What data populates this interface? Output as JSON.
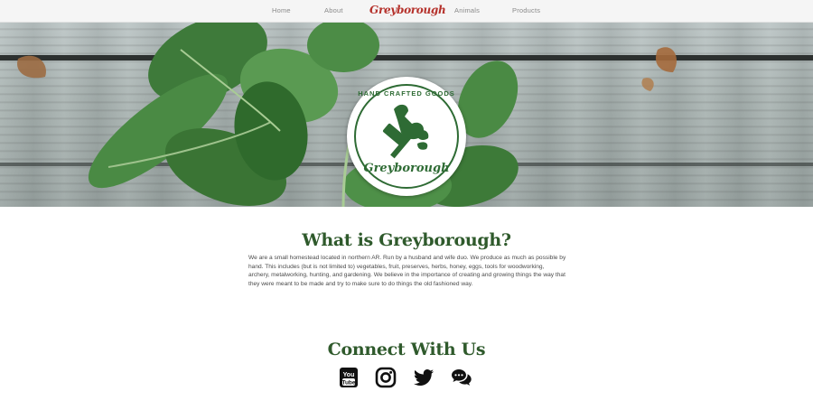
{
  "nav": {
    "items": [
      {
        "label": "Home"
      },
      {
        "label": "About"
      },
      {
        "label": "Animals"
      },
      {
        "label": "Products"
      }
    ],
    "brand": "Greyborough"
  },
  "hero": {
    "badge_top": "HAND CRAFTED GOODS",
    "badge_name": "Greyborough",
    "icon": "rooster-hammer-logo"
  },
  "about": {
    "title": "What is Greyborough?",
    "text": "We are a small homestead located in northern AR. Run by a husband and wife duo. We produce as much as possible by hand. This includes (but is not limited to) vegetables, fruit, preserves, herbs, honey, eggs, tools for woodworking, archery, metalworking, hunting, and gardening. We believe in the importance of creating and growing things the way that they were meant to be made and try to make sure to do things the old fashioned way."
  },
  "connect": {
    "title": "Connect With Us",
    "icons": [
      "youtube-icon",
      "instagram-icon",
      "twitter-icon",
      "chat-icon"
    ]
  },
  "colors": {
    "heading": "#2f5a2c",
    "brand": "#b5312b",
    "badge_green": "#2e6b34"
  }
}
